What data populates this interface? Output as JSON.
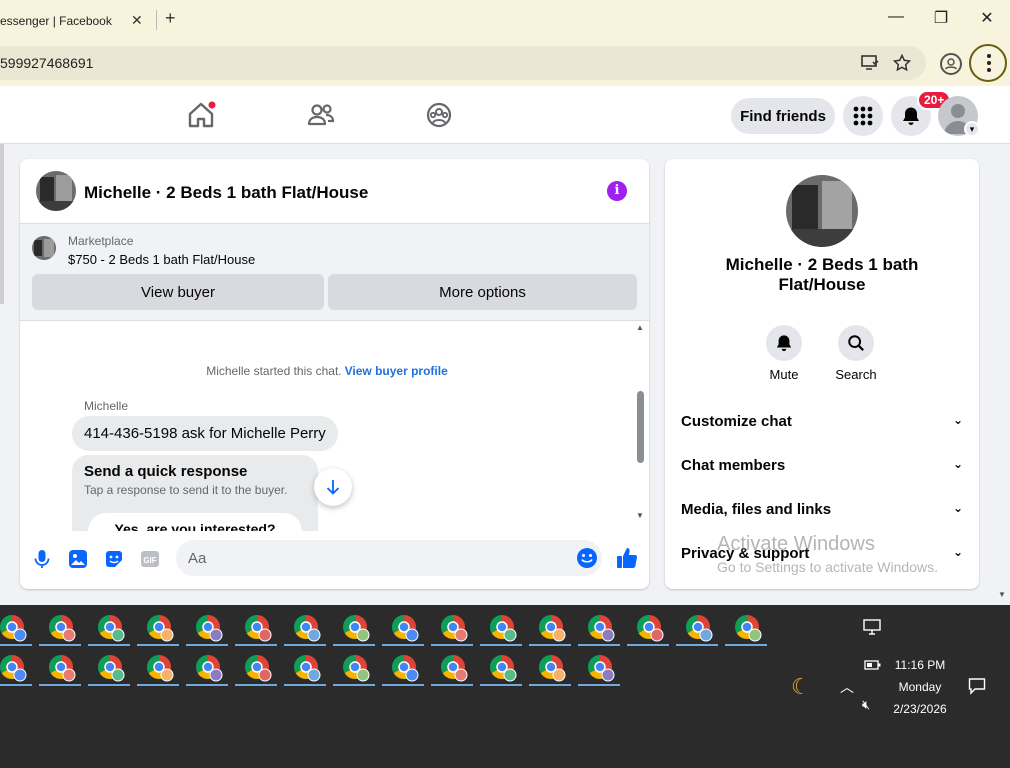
{
  "browser": {
    "tab_title": "essenger | Facebook",
    "tab_close": "✕",
    "new_tab": "+",
    "minimize": "—",
    "maximize": "❐",
    "close": "✕",
    "url": "599927468691"
  },
  "header": {
    "find_friends": "Find friends",
    "notification_badge": "20+"
  },
  "chat": {
    "title": "Michelle · 2 Beds 1 bath Flat/House",
    "info_glyph": "i",
    "marketplace_label": "Marketplace",
    "listing": "$750 - 2 Beds 1 bath Flat/House",
    "view_buyer": "View buyer",
    "more_options": "More options",
    "system_text": "Michelle started this chat.",
    "system_link": "View buyer profile",
    "sender": "Michelle",
    "message": "414-436-5198 ask for Michelle Perry",
    "quick_title": "Send a quick response",
    "quick_sub": "Tap a response to send it to the buyer.",
    "quick_option": "Yes, are you interested?",
    "composer_placeholder": "Aa"
  },
  "info_panel": {
    "name": "Michelle · 2 Beds 1 bath Flat/House",
    "mute": "Mute",
    "search": "Search",
    "sections": [
      "Customize chat",
      "Chat members",
      "Media, files and links",
      "Privacy & support"
    ]
  },
  "watermark": {
    "line1": "Activate Windows",
    "line2": "Go to Settings to activate Windows."
  },
  "taskbar": {
    "time": "11:16 PM",
    "day": "Monday",
    "date": "2/23/2026"
  },
  "colors": {
    "brand_blue": "#0866ff",
    "accent_purple": "#a020f0",
    "badge_red": "#e41e3f",
    "chrome_bg": "#f8f3dc"
  }
}
